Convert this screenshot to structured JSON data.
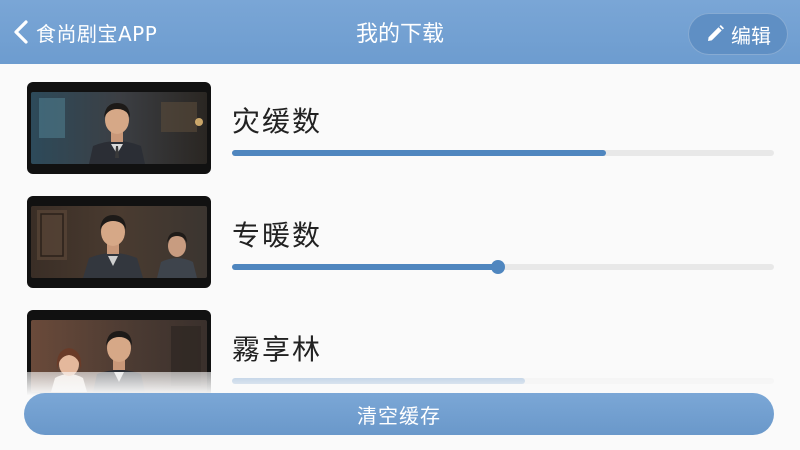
{
  "header": {
    "back_icon": "chevron-left-icon",
    "app_name": "食尚剧宝APP",
    "title": "我的下载",
    "edit_icon": "pencil-icon",
    "edit_label": "编辑"
  },
  "downloads": [
    {
      "title": "灾缓数",
      "progress": 0.69,
      "thumbnail": "drama-still-man-in-suit"
    },
    {
      "title": "专暖数",
      "progress": 0.49,
      "thumbnail": "drama-still-two-men-office"
    },
    {
      "title": "霧享林",
      "progress": 0.54,
      "thumbnail": "drama-still-couple"
    }
  ],
  "footer": {
    "clear_label": "清空缓存"
  },
  "colors": {
    "header": "#6d9ccf",
    "accent": "#4f86bf",
    "track": "#e8e8e8"
  }
}
